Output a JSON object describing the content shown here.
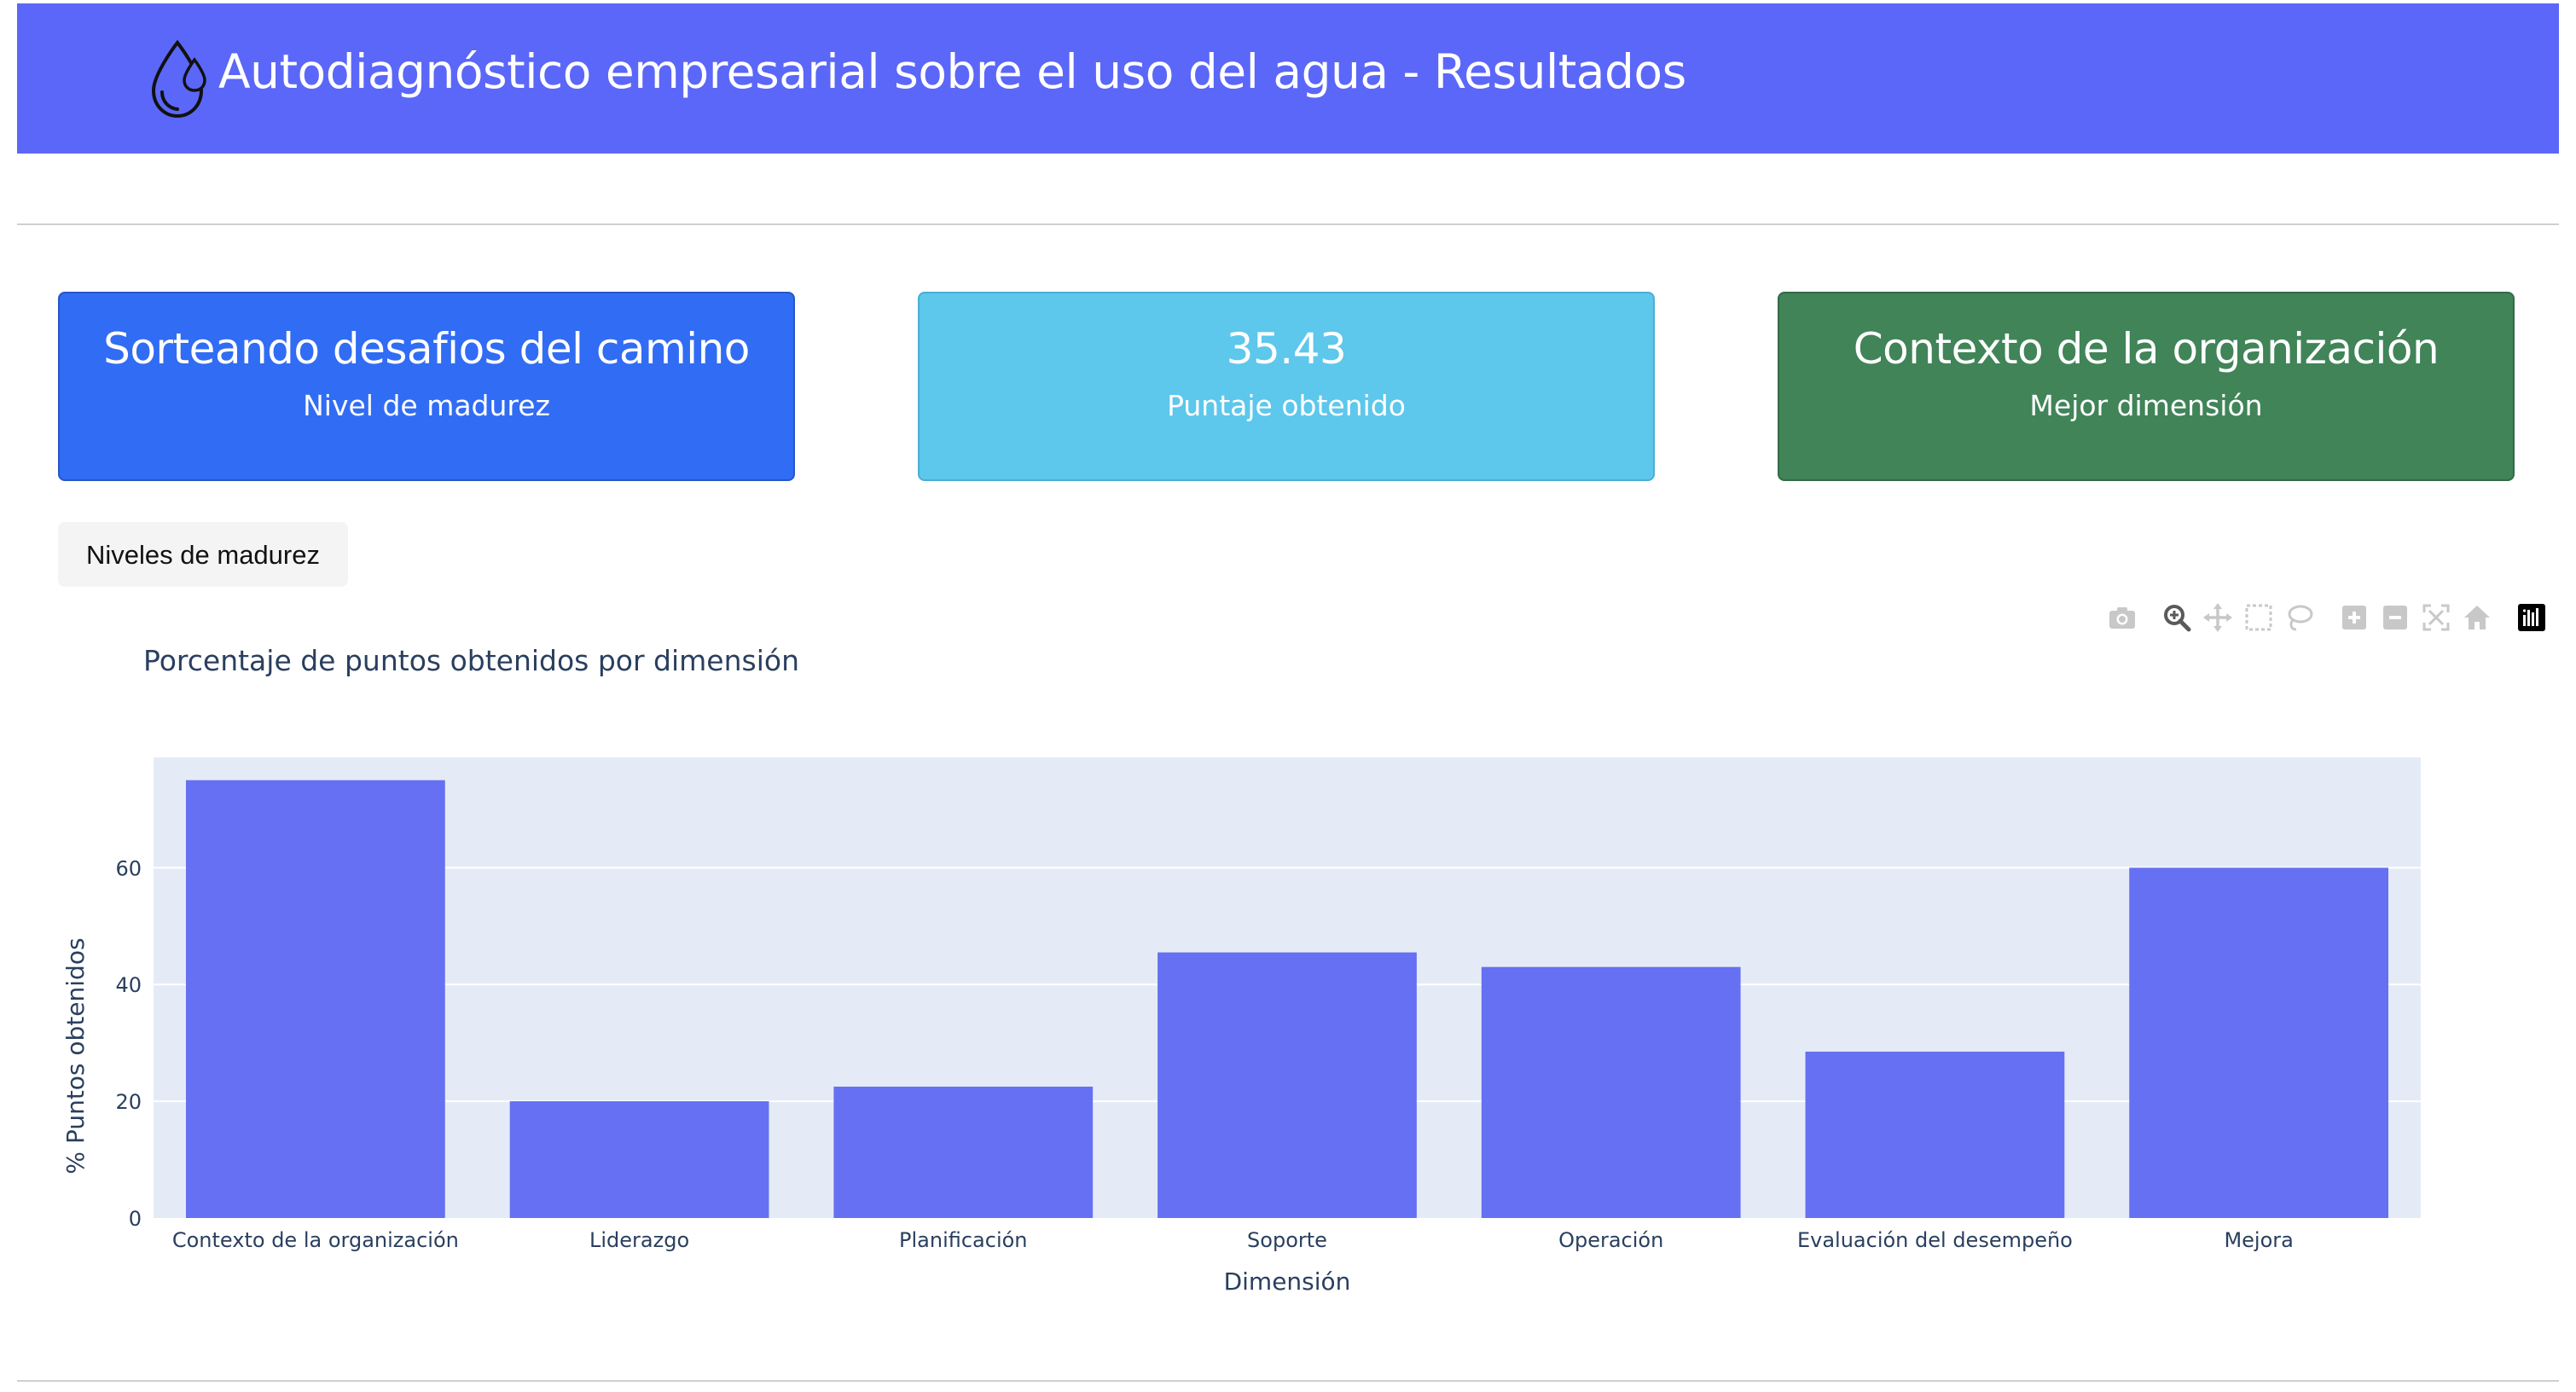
{
  "header": {
    "title": "Autodiagnóstico empresarial sobre el uso del agua - Resultados",
    "icon": "water-drops-icon",
    "background_color": "#5b67f8"
  },
  "cards": [
    {
      "value": "Sorteando desafios del camino",
      "label": "Nivel de madurez",
      "color": "#316cf4"
    },
    {
      "value": "35.43",
      "label": "Puntaje obtenido",
      "color": "#5dc7ec"
    },
    {
      "value": "Contexto de la organización",
      "label": "Mejor dimensión",
      "color": "#408458"
    }
  ],
  "tab_button": {
    "label": "Niveles de madurez"
  },
  "modebar": {
    "buttons": [
      "camera-icon",
      "zoom-icon",
      "pan-icon",
      "box-select-icon",
      "lasso-select-icon",
      "zoom-in-icon",
      "zoom-out-icon",
      "autoscale-icon",
      "reset-axes-icon",
      "plotly-logo-icon"
    ]
  },
  "chart_data": {
    "type": "bar",
    "title": "Porcentaje de puntos obtenidos por dimensión",
    "xlabel": "Dimensión",
    "ylabel": "% Puntos obtenidos",
    "categories": [
      "Contexto de la organización",
      "Liderazgo",
      "Planificación",
      "Soporte",
      "Operación",
      "Evaluación del desempeño",
      "Mejora"
    ],
    "values": [
      75,
      20,
      22.5,
      45.5,
      43,
      28.5,
      60
    ],
    "yticks": [
      0,
      20,
      40,
      60
    ],
    "ylim": [
      0,
      78.9
    ],
    "grid": true,
    "bar_color": "#6570f2",
    "plot_background": "#e5ebf6"
  }
}
